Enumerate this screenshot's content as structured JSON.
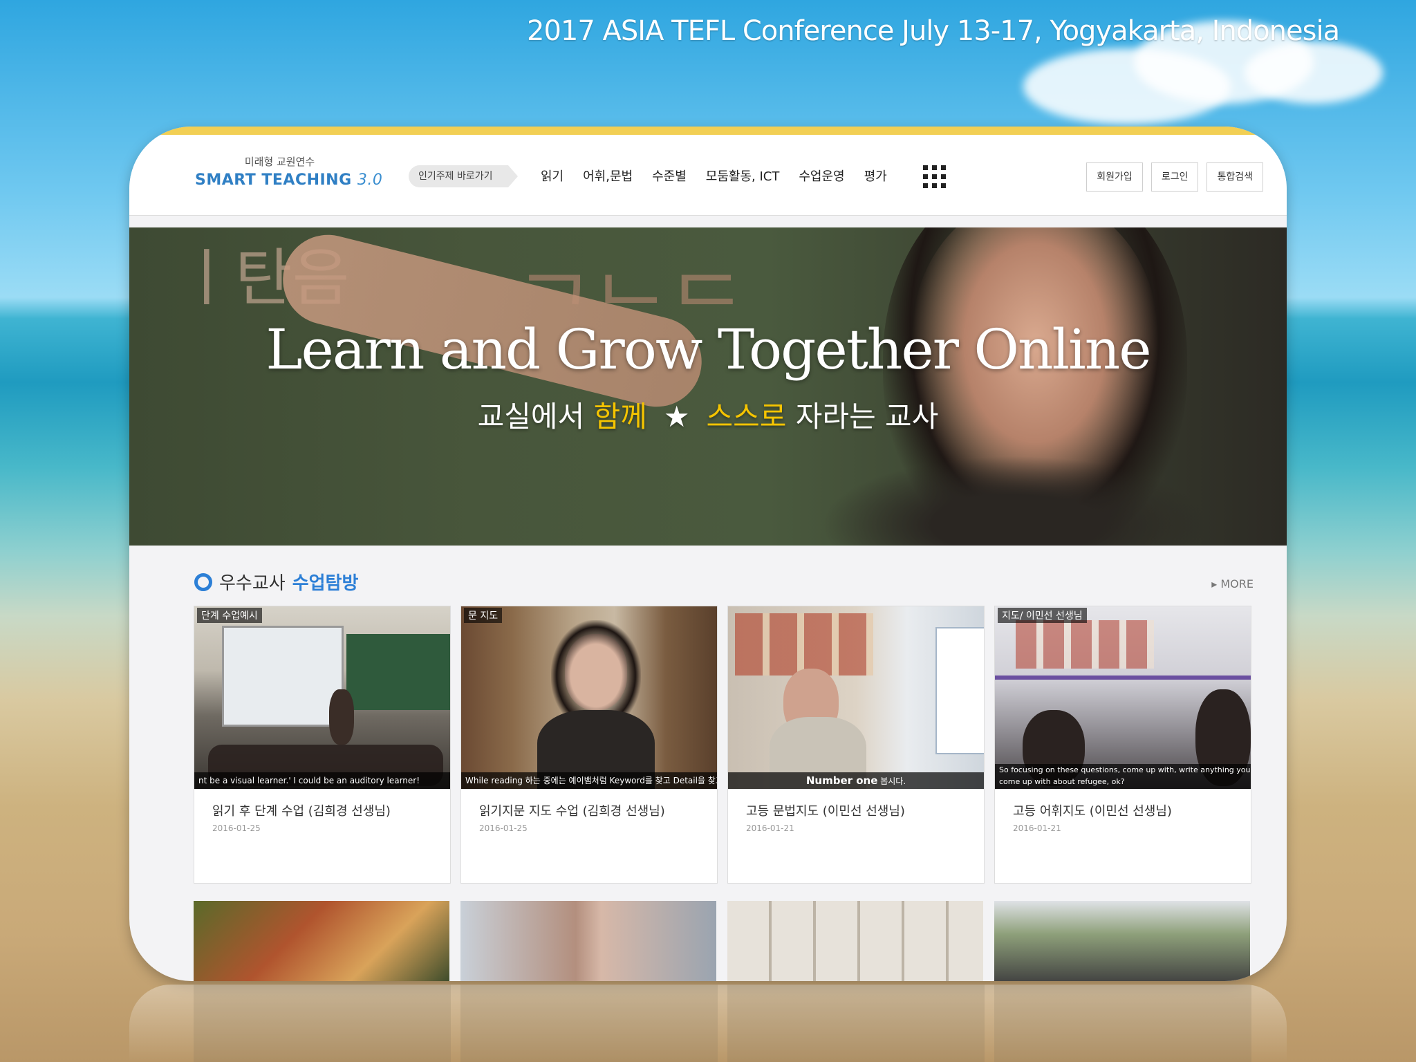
{
  "conference": {
    "title": "2017 ASIA TEFL Conference July 13-17, Yogyakarta, Indonesia"
  },
  "site": {
    "logo": {
      "subtitle": "미래형 교원연수",
      "name": "SMART TEACHING",
      "version": "3.0"
    },
    "quick_link": "인기주제 바로가기",
    "nav": [
      "읽기",
      "어휘,문법",
      "수준별",
      "모둠활동, ICT",
      "수업운영",
      "평가"
    ],
    "buttons": {
      "signup": "회원가입",
      "login": "로그인",
      "search": "통합검색"
    }
  },
  "hero": {
    "title": "Learn and Grow Together Online",
    "sub_part1": "교실에서 ",
    "sub_hl1": "함께",
    "sub_star": "★",
    "sub_hl2": "스스로",
    "sub_part2": " 자라는 교사"
  },
  "section": {
    "title": "우수교사 ",
    "title_hl": "수업탐방",
    "more": "▸ MORE"
  },
  "cards": [
    {
      "label": "단계 수업예시",
      "caption": "nt be a visual learner.' I could be an auditory learner!",
      "title": "읽기 후 단계 수업 (김희경 선생님)",
      "date": "2016-01-25"
    },
    {
      "label": "문 지도",
      "caption": "While reading 하는 중에는 예이뱀처럼 Keyword를 찾고 Detail을 찾고",
      "title": "읽기지문 지도 수업 (김희경 선생님)",
      "date": "2016-01-25"
    },
    {
      "label": "",
      "caption_bold": "Number one",
      "caption": " 봅시다.",
      "title": "고등 문법지도 (이민선 선생님)",
      "date": "2016-01-21"
    },
    {
      "label": "지도/ 이민선 선생님",
      "caption": "So focusing on these questions, come up with, write anything you come up with about refugee, ok?",
      "title": "고등 어휘지도 (이민선 선생님)",
      "date": "2016-01-21"
    }
  ],
  "colors": {
    "accent": "#2c7fd6",
    "highlight": "#f5c400",
    "topline": "#f2cf54"
  }
}
